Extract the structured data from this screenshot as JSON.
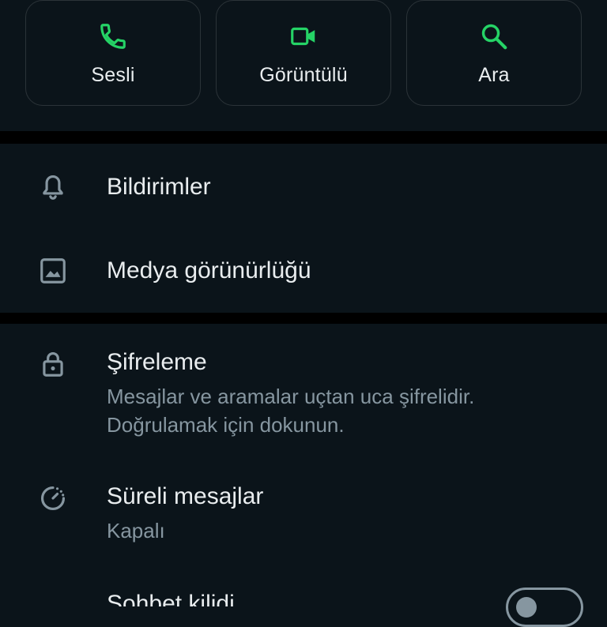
{
  "actions": {
    "voice_label": "Sesli",
    "video_label": "Görüntülü",
    "search_label": "Ara"
  },
  "settings": {
    "notifications": {
      "title": "Bildirimler"
    },
    "media_visibility": {
      "title": "Medya görünürlüğü"
    },
    "encryption": {
      "title": "Şifreleme",
      "subtitle_line1": "Mesajlar ve aramalar uçtan uca şifrelidir.",
      "subtitle_line2": "Doğrulamak için dokunun."
    },
    "disappearing": {
      "title": "Süreli mesajlar",
      "subtitle": "Kapalı"
    },
    "chat_lock": {
      "title": "Sohbet kilidi",
      "enabled": false
    }
  },
  "colors": {
    "background": "#0b141a",
    "accent": "#25d366",
    "text_primary": "#e9edef",
    "text_secondary": "#8696a0",
    "divider": "#000000"
  },
  "icons": {
    "voice": "phone-icon",
    "video": "video-icon",
    "search": "search-icon",
    "notifications": "bell-icon",
    "media": "image-icon",
    "encryption": "lock-icon",
    "disappearing": "timer-icon"
  }
}
